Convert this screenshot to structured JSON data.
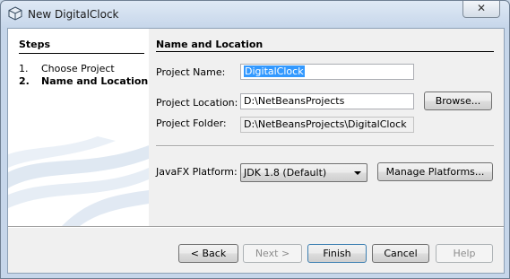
{
  "window": {
    "title": "New DigitalClock",
    "close_glyph": "✕"
  },
  "steps": {
    "title": "Steps",
    "items": [
      {
        "num": "1.",
        "label": "Choose Project"
      },
      {
        "num": "2.",
        "label": "Name and Location"
      }
    ]
  },
  "content": {
    "title": "Name and Location",
    "project_name_label": "Project Name:",
    "project_name_value": "DigitalClock",
    "project_location_label": "Project Location:",
    "project_location_value": "D:\\NetBeansProjects",
    "browse_label": "Browse...",
    "project_folder_label": "Project Folder:",
    "project_folder_value": "D:\\NetBeansProjects\\DigitalClock",
    "platform_label": "JavaFX Platform:",
    "platform_value": "JDK 1.8 (Default)",
    "manage_platforms_label": "Manage Platforms..."
  },
  "footer": {
    "back": "< Back",
    "next": "Next >",
    "finish": "Finish",
    "cancel": "Cancel",
    "help": "Help"
  },
  "colors": {
    "selection": "#3399ff",
    "title_bar": "#c6d6ea"
  }
}
